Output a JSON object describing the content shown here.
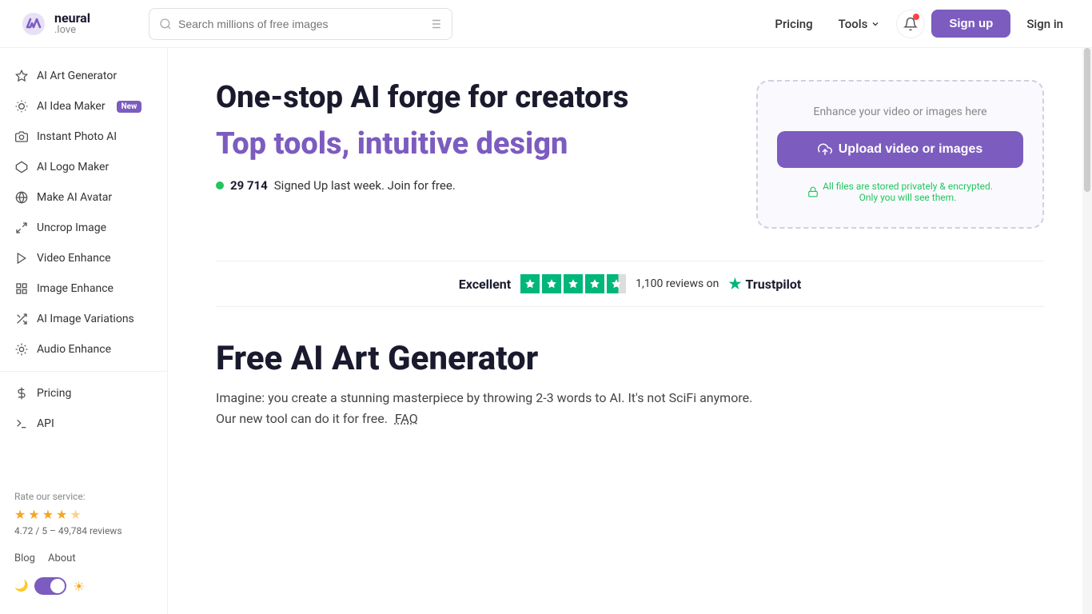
{
  "logo": {
    "name": "neural",
    "domain": ".love"
  },
  "header": {
    "search_placeholder": "Search millions of free images",
    "pricing_label": "Pricing",
    "tools_label": "Tools",
    "signup_label": "Sign up",
    "signin_label": "Sign in"
  },
  "sidebar": {
    "items": [
      {
        "id": "ai-art-generator",
        "label": "AI Art Generator",
        "icon": "sparkle"
      },
      {
        "id": "ai-idea-maker",
        "label": "AI Idea Maker",
        "icon": "bulb",
        "badge": "New"
      },
      {
        "id": "instant-photo-ai",
        "label": "Instant Photo AI",
        "icon": "camera"
      },
      {
        "id": "ai-logo-maker",
        "label": "AI Logo Maker",
        "icon": "diamond"
      },
      {
        "id": "make-ai-avatar",
        "label": "Make AI Avatar",
        "icon": "globe"
      },
      {
        "id": "uncrop-image",
        "label": "Uncrop Image",
        "icon": "arrow-expand"
      },
      {
        "id": "video-enhance",
        "label": "Video Enhance",
        "icon": "play"
      },
      {
        "id": "image-enhance",
        "label": "Image Enhance",
        "icon": "grid"
      },
      {
        "id": "ai-image-variations",
        "label": "AI Image Variations",
        "icon": "shuffle"
      },
      {
        "id": "audio-enhance",
        "label": "Audio Enhance",
        "icon": "audio"
      },
      {
        "id": "pricing",
        "label": "Pricing",
        "icon": "dollar"
      },
      {
        "id": "api",
        "label": "API",
        "icon": "terminal"
      }
    ],
    "rate_label": "Rate our service:",
    "rating": "4.72",
    "rating_max": "5",
    "review_count": "49,784",
    "reviews_label": "reviews",
    "blog_label": "Blog",
    "about_label": "About"
  },
  "hero": {
    "title": "One-stop AI forge for creators",
    "subtitle": "Top tools, intuitive design",
    "signups_count": "29 714",
    "signups_text": "Signed Up last week. Join for free."
  },
  "upload_card": {
    "hint": "Enhance your video or images here",
    "btn_label": "Upload video or images",
    "privacy_text": "All files are stored privately & encrypted.",
    "privacy_text2": "Only you will see them."
  },
  "trustpilot": {
    "excellent_label": "Excellent",
    "reviews_count": "1,100",
    "reviews_label": "reviews on",
    "brand": "Trustpilot"
  },
  "section": {
    "title": "Free AI Art Generator",
    "desc": "Imagine: you create a stunning masterpiece by throwing 2-3 words to AI. It's not SciFi anymore.",
    "desc2": "Our new tool can do it for free.",
    "faq_label": "FAQ"
  }
}
